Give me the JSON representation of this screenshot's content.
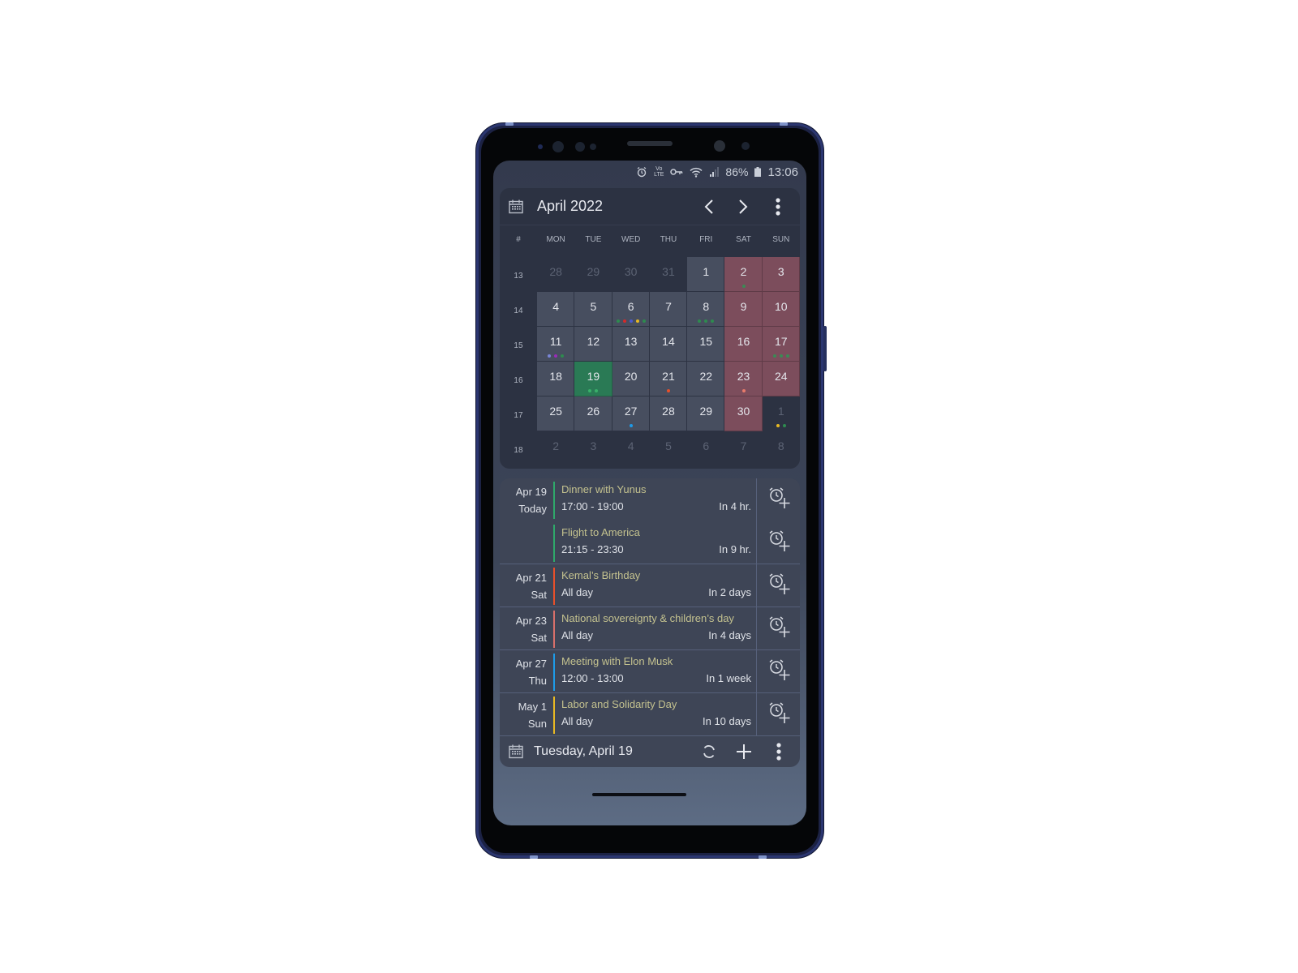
{
  "status_bar": {
    "icons": [
      "alarm-icon",
      "volte-icon",
      "vpn-key-icon",
      "wifi-icon",
      "signal-icon",
      "battery-icon"
    ],
    "volte_top": "Vo",
    "volte_bottom": "LTE",
    "battery": "86%",
    "time": "13:06"
  },
  "calendar": {
    "title": "April 2022",
    "prev_icon": "chevron-left-icon",
    "next_icon": "chevron-right-icon",
    "menu_icon": "more-vertical-icon",
    "week_header": "#",
    "weekdays": [
      "MON",
      "TUE",
      "WED",
      "THU",
      "FRI",
      "SAT",
      "SUN"
    ],
    "weeks": [
      {
        "num": "13",
        "days": [
          {
            "d": "28",
            "t": "other"
          },
          {
            "d": "29",
            "t": "other"
          },
          {
            "d": "30",
            "t": "other"
          },
          {
            "d": "31",
            "t": "other"
          },
          {
            "d": "1",
            "t": "cur"
          },
          {
            "d": "2",
            "t": "wkend",
            "dots": [
              "#3b8a55"
            ]
          },
          {
            "d": "3",
            "t": "wkend"
          }
        ]
      },
      {
        "num": "14",
        "days": [
          {
            "d": "4",
            "t": "cur"
          },
          {
            "d": "5",
            "t": "cur"
          },
          {
            "d": "6",
            "t": "cur",
            "dots": [
              "#2e8b4f",
              "#d42a2a",
              "#4a5ad0",
              "#e8b923",
              "#2e8b4f"
            ]
          },
          {
            "d": "7",
            "t": "cur"
          },
          {
            "d": "8",
            "t": "cur",
            "dots": [
              "#2e8b4f",
              "#2e8b4f",
              "#2e8b4f"
            ]
          },
          {
            "d": "9",
            "t": "wkend"
          },
          {
            "d": "10",
            "t": "wkend"
          }
        ]
      },
      {
        "num": "15",
        "days": [
          {
            "d": "11",
            "t": "cur",
            "dots": [
              "#7a86d8",
              "#9a2bb8",
              "#2e8b4f"
            ]
          },
          {
            "d": "12",
            "t": "cur"
          },
          {
            "d": "13",
            "t": "cur"
          },
          {
            "d": "14",
            "t": "cur"
          },
          {
            "d": "15",
            "t": "cur"
          },
          {
            "d": "16",
            "t": "wkend"
          },
          {
            "d": "17",
            "t": "wkend",
            "dots": [
              "#3b8a55",
              "#3b8a55",
              "#3b8a55"
            ]
          }
        ]
      },
      {
        "num": "16",
        "days": [
          {
            "d": "18",
            "t": "cur"
          },
          {
            "d": "19",
            "t": "today",
            "dots": [
              "#39b06a",
              "#39b06a"
            ]
          },
          {
            "d": "20",
            "t": "cur"
          },
          {
            "d": "21",
            "t": "cur",
            "dots": [
              "#e8502a"
            ]
          },
          {
            "d": "22",
            "t": "cur"
          },
          {
            "d": "23",
            "t": "wkend",
            "dots": [
              "#e87a6a"
            ]
          },
          {
            "d": "24",
            "t": "wkend"
          }
        ]
      },
      {
        "num": "17",
        "days": [
          {
            "d": "25",
            "t": "cur"
          },
          {
            "d": "26",
            "t": "cur"
          },
          {
            "d": "27",
            "t": "cur",
            "dots": [
              "#1e9be8"
            ]
          },
          {
            "d": "28",
            "t": "cur"
          },
          {
            "d": "29",
            "t": "cur"
          },
          {
            "d": "30",
            "t": "wkend"
          },
          {
            "d": "1",
            "t": "other",
            "dots": [
              "#e8b923",
              "#2e8b4f"
            ]
          }
        ]
      },
      {
        "num": "18",
        "days": [
          {
            "d": "2",
            "t": "other"
          },
          {
            "d": "3",
            "t": "other"
          },
          {
            "d": "4",
            "t": "other"
          },
          {
            "d": "5",
            "t": "other"
          },
          {
            "d": "6",
            "t": "other"
          },
          {
            "d": "7",
            "t": "other"
          },
          {
            "d": "8",
            "t": "other"
          }
        ]
      }
    ]
  },
  "events": [
    {
      "date": "Apr 19",
      "day": "Today",
      "title": "Dinner with Yunus",
      "time": "17:00 - 19:00",
      "relative": "In 4 hr.",
      "color": "#2fa86a"
    },
    {
      "date": "",
      "day": "",
      "title": "Flight to America",
      "time": "21:15 - 23:30",
      "relative": "In 9 hr.",
      "color": "#2fa86a"
    },
    {
      "date": "Apr 21",
      "day": "Sat",
      "title": "Kemal’s Birthday",
      "time": "All day",
      "relative": "In 2 days",
      "color": "#e8502a"
    },
    {
      "date": "Apr 23",
      "day": "Sat",
      "title": "National sovereignty & children’s day",
      "time": "All day",
      "relative": "In 4 days",
      "color": "#d8706a"
    },
    {
      "date": "Apr 27",
      "day": "Thu",
      "title": "Meeting with Elon Musk",
      "time": "12:00 - 13:00",
      "relative": "In 1 week",
      "color": "#1e9be8"
    },
    {
      "date": "May 1",
      "day": "Sun",
      "title": "Labor and Solidarity Day",
      "time": "All day",
      "relative": "In 10 days",
      "color": "#e8b923"
    }
  ],
  "footer": {
    "title": "Tuesday, April 19",
    "refresh_icon": "refresh-icon",
    "add_icon": "plus-icon",
    "menu_icon": "more-vertical-icon"
  }
}
